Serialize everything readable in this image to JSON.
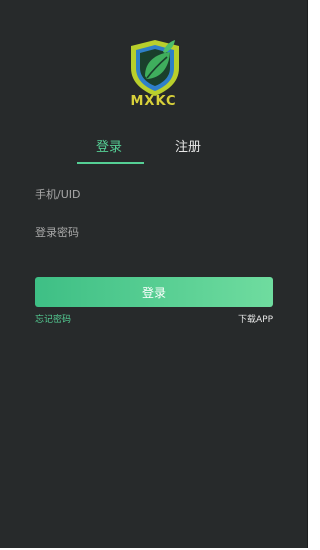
{
  "brand": {
    "name": "MXKC",
    "logo_icon": "shield-leaf-icon"
  },
  "tabs": [
    {
      "label": "登录",
      "active": true
    },
    {
      "label": "注册",
      "active": false
    }
  ],
  "form": {
    "uid_placeholder": "手机/UID",
    "uid_value": "",
    "password_placeholder": "登录密码",
    "password_value": "",
    "submit_label": "登录"
  },
  "links": {
    "forgot_password": "忘记密码",
    "download_app": "下载APP"
  },
  "colors": {
    "background": "#272a2b",
    "accent": "#55cf95",
    "brand_text": "#d8d13a",
    "button_gradient_start": "#3ebf85",
    "button_gradient_end": "#6fdc9f"
  }
}
